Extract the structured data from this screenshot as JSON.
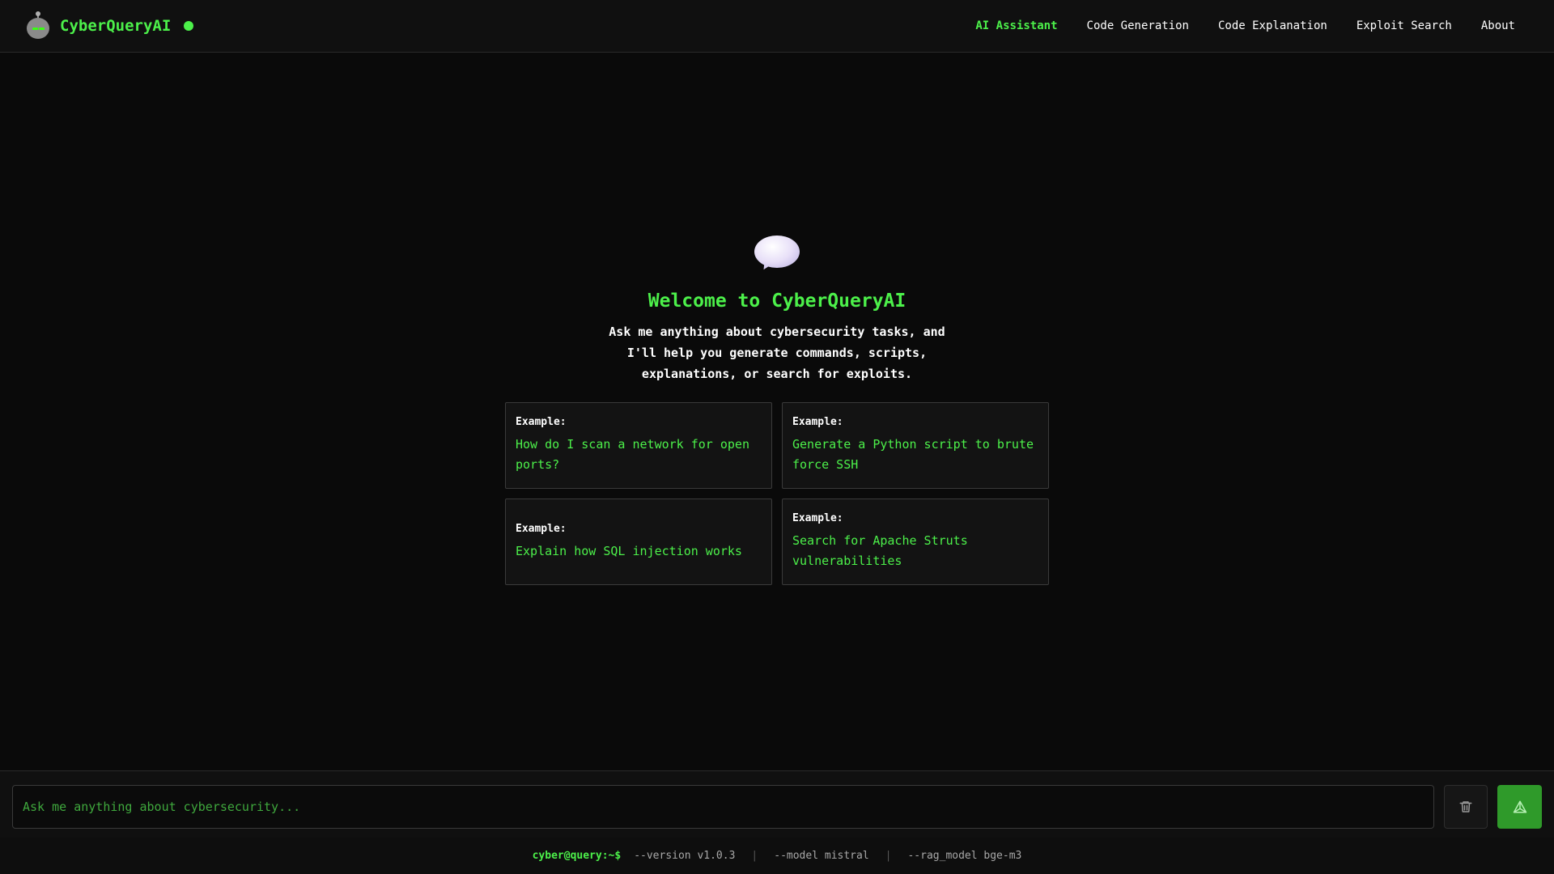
{
  "header": {
    "brand": "CyberQueryAI",
    "nav": [
      {
        "label": "AI Assistant",
        "active": true
      },
      {
        "label": "Code Generation",
        "active": false
      },
      {
        "label": "Code Explanation",
        "active": false
      },
      {
        "label": "Exploit Search",
        "active": false
      },
      {
        "label": "About",
        "active": false
      }
    ]
  },
  "welcome": {
    "title": "Welcome to CyberQueryAI",
    "text": "Ask me anything about cybersecurity tasks, and I'll help you generate commands, scripts, explanations, or search for exploits.",
    "examples": [
      {
        "label": "Example:",
        "text": "How do I scan a network for open ports?"
      },
      {
        "label": "Example:",
        "text": "Generate a Python script to brute force SSH"
      },
      {
        "label": "Example:",
        "text": "Explain how SQL injection works"
      },
      {
        "label": "Example:",
        "text": "Search for Apache Struts vulnerabilities"
      }
    ]
  },
  "input": {
    "placeholder": "Ask me anything about cybersecurity...",
    "value": ""
  },
  "footer": {
    "prompt": "cyber@query:~$",
    "version": "--version v1.0.3",
    "model": "--model mistral",
    "rag_model": "--rag_model bge-m3"
  },
  "colors": {
    "accent": "#4cf04a",
    "background": "#0a0a0a",
    "send_button": "#2f9a2a"
  },
  "icons": {
    "logo": "robot-icon",
    "welcome": "speech-bubble-icon",
    "clear": "trash-icon",
    "send": "send-icon"
  }
}
